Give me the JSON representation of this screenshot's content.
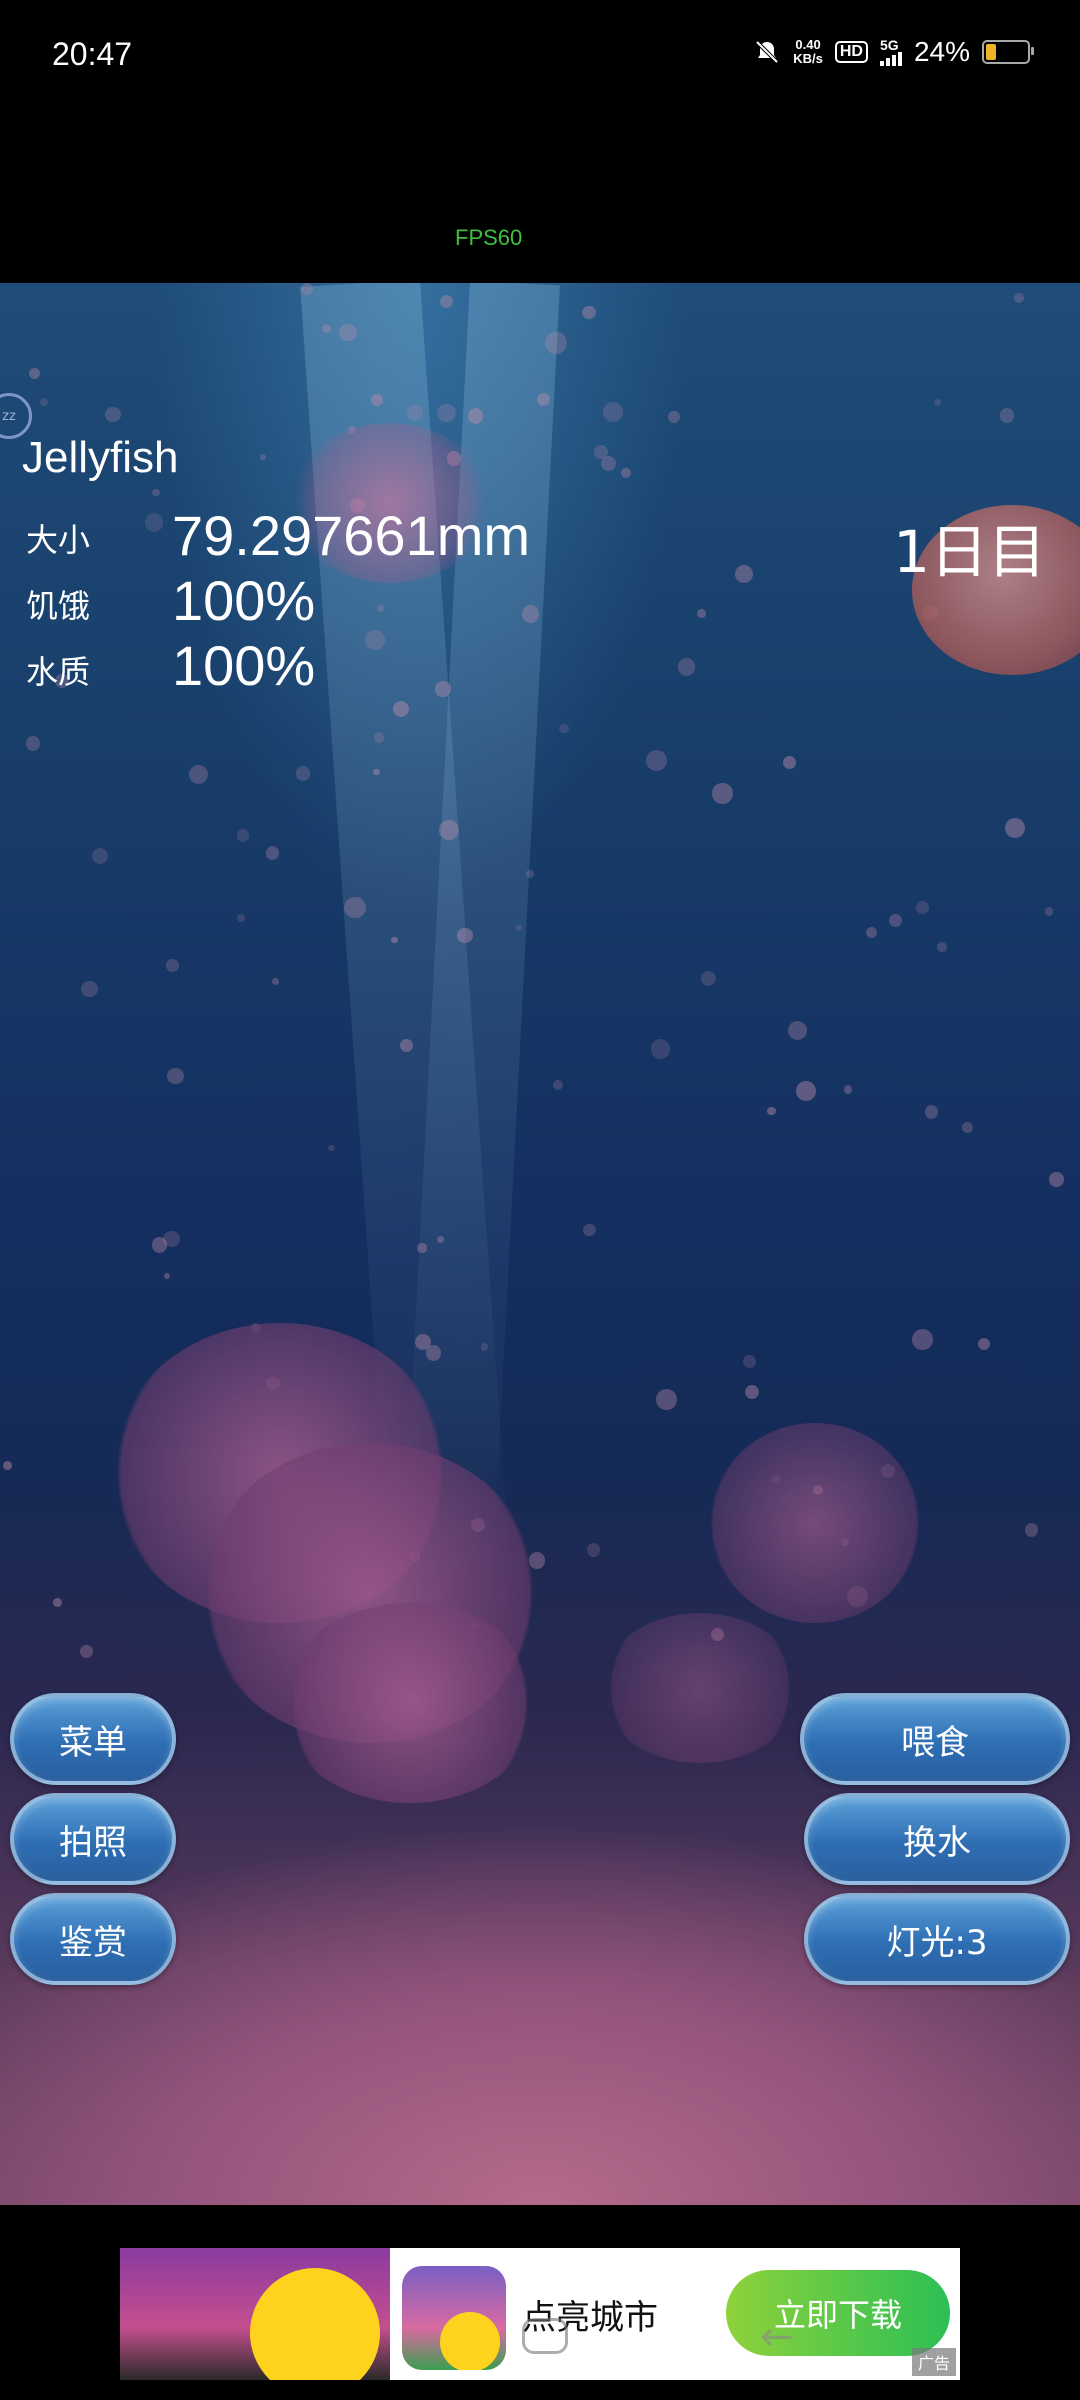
{
  "status_bar": {
    "time": "20:47",
    "net_speed_value": "0.40",
    "net_speed_unit": "KB/s",
    "hd": "HD",
    "network": "5G",
    "battery": "24%",
    "battery_level": 0.24,
    "icons": [
      "mute-icon",
      "hd-icon",
      "signal-icon",
      "battery-icon"
    ]
  },
  "fps": "FPS60",
  "pet": {
    "name": "Jellyfish",
    "stats": [
      {
        "label": "大小",
        "value": "79.297661mm"
      },
      {
        "label": "饥饿",
        "value": "100%"
      },
      {
        "label": "水质",
        "value": "100%"
      }
    ],
    "day": "1日目"
  },
  "sleep_icon_text": "zz",
  "left_buttons": [
    {
      "label": "菜单"
    },
    {
      "label": "拍照"
    },
    {
      "label": "鉴赏"
    }
  ],
  "right_buttons": [
    {
      "label": "喂食"
    },
    {
      "label": "换水"
    },
    {
      "label": "灯光:3"
    }
  ],
  "ad": {
    "title": "点亮城市",
    "cta": "立即下载",
    "tag": "广告"
  },
  "colors": {
    "button_blue": "#2e6eb4",
    "fps_green": "#3fbf3f",
    "cta_green": "#2bbf55"
  }
}
